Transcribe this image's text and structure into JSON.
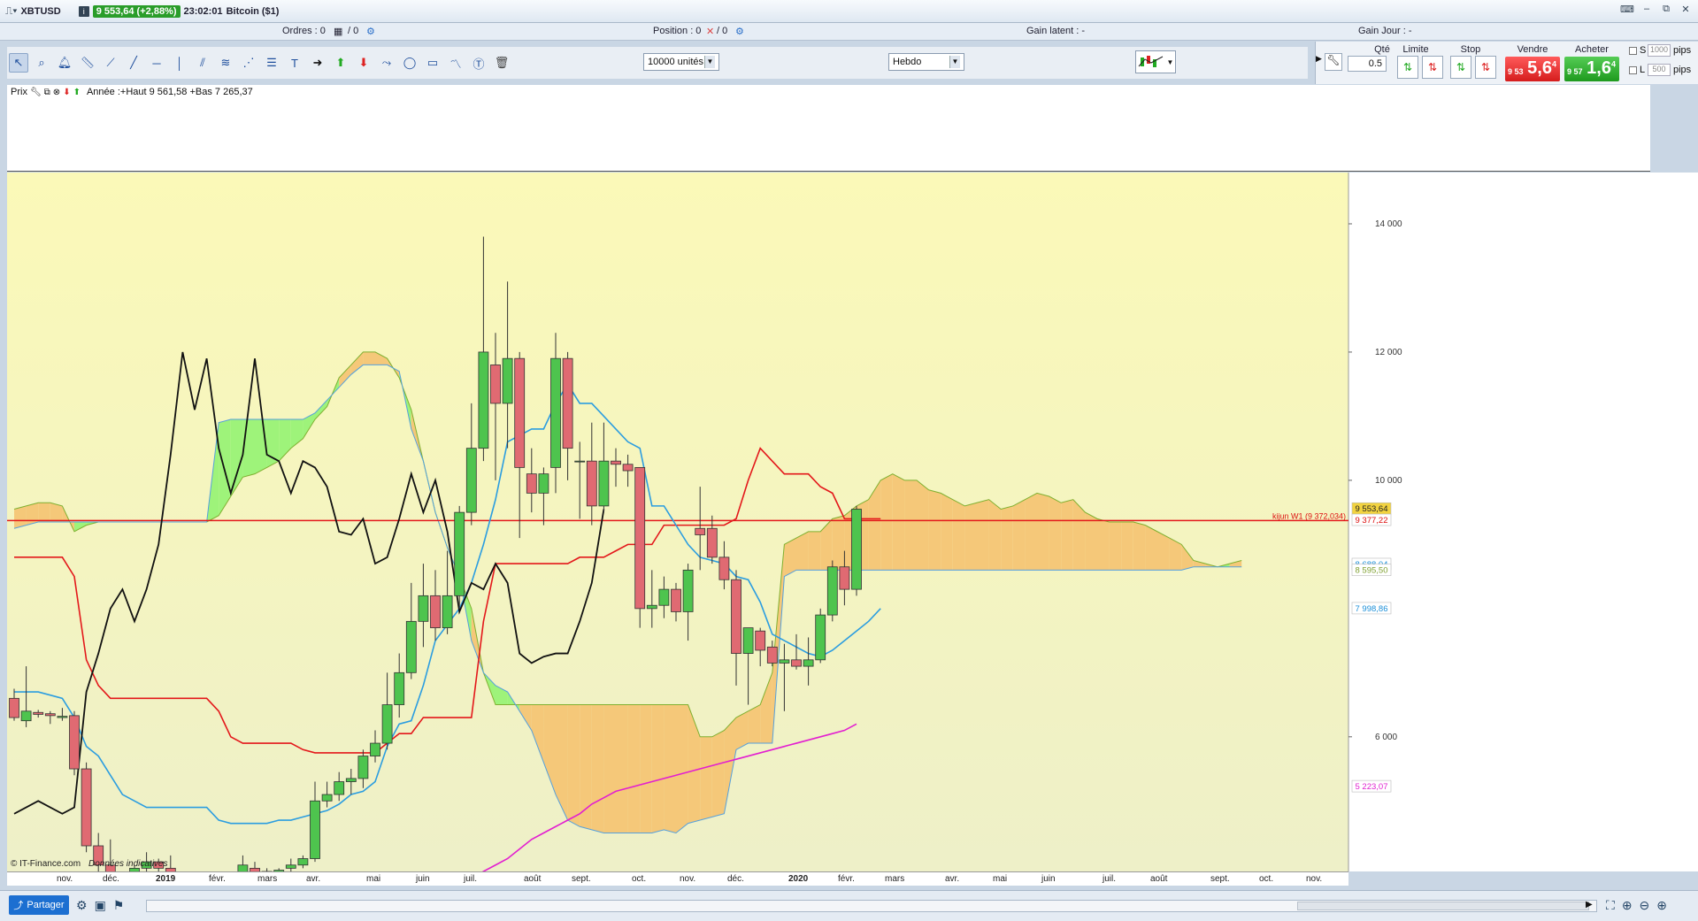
{
  "window": {
    "symbol": "XBTUSD",
    "price_badge": "9 553,64 (+2,88%)",
    "time": "23:02:01",
    "instrument": "Bitcoin ($1)"
  },
  "status": {
    "ordres": "Ordres : 0",
    "ordres_total": "/ 0",
    "position": "Position : 0",
    "position_total": "/ 0",
    "gain_latent": "Gain latent : -",
    "gain_jour": "Gain Jour : -"
  },
  "toolbar": {
    "units_select": "10000 unités",
    "period_select": "Hebdo"
  },
  "order_panel": {
    "qty_label": "Qté",
    "qty_value": "0.5",
    "limit_label": "Limite",
    "stop_label": "Stop",
    "sell_label": "Vendre",
    "buy_label": "Acheter",
    "sell_small": "9 53",
    "sell_big": "5,6",
    "sell_sup": "4",
    "buy_small": "9 57",
    "buy_big": "1,6",
    "buy_sup": "4",
    "s_label": "S",
    "l_label": "L",
    "s_pips": "1000",
    "l_pips": "500",
    "pips": "pips",
    "pips2": "pips"
  },
  "indicator_bar": {
    "prix_label": "Prix",
    "legend_text": "Année :+Haut 9 561,58 +Bas 7 265,37"
  },
  "chart_data": {
    "type": "candlestick",
    "ylim": [
      3900,
      14800
    ],
    "y_ticks": [
      "14 000",
      "12 000",
      "10 000",
      "6 000"
    ],
    "y_tick_values": [
      14000,
      12000,
      10000,
      6000
    ],
    "x_labels": [
      "nov.",
      "déc.",
      "2019",
      "févr.",
      "mars",
      "avr.",
      "mai",
      "juin",
      "juil.",
      "août",
      "sept.",
      "oct.",
      "nov.",
      "déc.",
      "2020",
      "févr.",
      "mars",
      "avr.",
      "mai",
      "juin",
      "juil.",
      "août",
      "sept.",
      "oct.",
      "nov."
    ],
    "x_bold": [
      "2019",
      "2020"
    ],
    "candles": [
      {
        "o": 6600,
        "h": 6750,
        "l": 6250,
        "c": 6300
      },
      {
        "o": 6250,
        "h": 7100,
        "l": 6150,
        "c": 6400
      },
      {
        "o": 6380,
        "h": 6420,
        "l": 6300,
        "c": 6350
      },
      {
        "o": 6360,
        "h": 6400,
        "l": 6200,
        "c": 6330
      },
      {
        "o": 6300,
        "h": 6450,
        "l": 6250,
        "c": 6320
      },
      {
        "o": 6330,
        "h": 6400,
        "l": 5400,
        "c": 5500
      },
      {
        "o": 5500,
        "h": 5600,
        "l": 4200,
        "c": 4300
      },
      {
        "o": 4300,
        "h": 4500,
        "l": 3700,
        "c": 4000
      },
      {
        "o": 4000,
        "h": 4400,
        "l": 3300,
        "c": 3500
      },
      {
        "o": 3500,
        "h": 3800,
        "l": 3200,
        "c": 3300
      },
      {
        "o": 3300,
        "h": 4000,
        "l": 3200,
        "c": 3950
      },
      {
        "o": 3950,
        "h": 4200,
        "l": 3800,
        "c": 4050
      },
      {
        "o": 4050,
        "h": 4100,
        "l": 3850,
        "c": 3950
      },
      {
        "o": 3950,
        "h": 4150,
        "l": 3650,
        "c": 3750
      },
      {
        "o": 3750,
        "h": 3850,
        "l": 3550,
        "c": 3650
      },
      {
        "o": 3650,
        "h": 3750,
        "l": 3450,
        "c": 3550
      },
      {
        "o": 3550,
        "h": 3700,
        "l": 3450,
        "c": 3650
      },
      {
        "o": 3620,
        "h": 3700,
        "l": 3500,
        "c": 3600
      },
      {
        "o": 3600,
        "h": 3900,
        "l": 3550,
        "c": 3750
      },
      {
        "o": 3700,
        "h": 4150,
        "l": 3650,
        "c": 4000
      },
      {
        "o": 3950,
        "h": 4050,
        "l": 3800,
        "c": 3880
      },
      {
        "o": 3880,
        "h": 3950,
        "l": 3800,
        "c": 3900
      },
      {
        "o": 3880,
        "h": 3950,
        "l": 3800,
        "c": 3920
      },
      {
        "o": 3950,
        "h": 4100,
        "l": 3900,
        "c": 4000
      },
      {
        "o": 4000,
        "h": 4150,
        "l": 3950,
        "c": 4100
      },
      {
        "o": 4100,
        "h": 5300,
        "l": 4050,
        "c": 5000
      },
      {
        "o": 5000,
        "h": 5300,
        "l": 4900,
        "c": 5100
      },
      {
        "o": 5100,
        "h": 5450,
        "l": 5000,
        "c": 5300
      },
      {
        "o": 5300,
        "h": 5500,
        "l": 5100,
        "c": 5350
      },
      {
        "o": 5350,
        "h": 5800,
        "l": 5200,
        "c": 5700
      },
      {
        "o": 5700,
        "h": 6100,
        "l": 5600,
        "c": 5900
      },
      {
        "o": 5900,
        "h": 7000,
        "l": 5800,
        "c": 6500
      },
      {
        "o": 6500,
        "h": 7300,
        "l": 6300,
        "c": 7000
      },
      {
        "o": 7000,
        "h": 8400,
        "l": 6900,
        "c": 7800
      },
      {
        "o": 7800,
        "h": 8700,
        "l": 7400,
        "c": 8200
      },
      {
        "o": 8200,
        "h": 8600,
        "l": 7500,
        "c": 7700
      },
      {
        "o": 7700,
        "h": 8900,
        "l": 7600,
        "c": 8200
      },
      {
        "o": 8200,
        "h": 9600,
        "l": 8000,
        "c": 9500
      },
      {
        "o": 9500,
        "h": 11200,
        "l": 9300,
        "c": 10500
      },
      {
        "o": 10500,
        "h": 13800,
        "l": 10300,
        "c": 12000
      },
      {
        "o": 11800,
        "h": 12300,
        "l": 10000,
        "c": 11200
      },
      {
        "o": 11200,
        "h": 13100,
        "l": 10500,
        "c": 11900
      },
      {
        "o": 11900,
        "h": 12000,
        "l": 9100,
        "c": 10200
      },
      {
        "o": 10100,
        "h": 10500,
        "l": 9500,
        "c": 9800
      },
      {
        "o": 9800,
        "h": 10200,
        "l": 9300,
        "c": 10100
      },
      {
        "o": 10200,
        "h": 12300,
        "l": 9800,
        "c": 11900
      },
      {
        "o": 11900,
        "h": 12000,
        "l": 10000,
        "c": 10500
      },
      {
        "o": 10300,
        "h": 10600,
        "l": 9400,
        "c": 10300
      },
      {
        "o": 10300,
        "h": 10900,
        "l": 9300,
        "c": 9600
      },
      {
        "o": 9600,
        "h": 10900,
        "l": 9500,
        "c": 10300
      },
      {
        "o": 10300,
        "h": 10500,
        "l": 9900,
        "c": 10250
      },
      {
        "o": 10250,
        "h": 10400,
        "l": 9900,
        "c": 10150
      },
      {
        "o": 10200,
        "h": 10200,
        "l": 7700,
        "c": 8000
      },
      {
        "o": 8000,
        "h": 8600,
        "l": 7700,
        "c": 8050
      },
      {
        "o": 8050,
        "h": 8500,
        "l": 7850,
        "c": 8300
      },
      {
        "o": 8300,
        "h": 8400,
        "l": 7800,
        "c": 7950
      },
      {
        "o": 7950,
        "h": 8700,
        "l": 7500,
        "c": 8600
      },
      {
        "o": 9250,
        "h": 9900,
        "l": 8600,
        "c": 9150
      },
      {
        "o": 9250,
        "h": 9450,
        "l": 8700,
        "c": 8800
      },
      {
        "o": 8800,
        "h": 9050,
        "l": 8300,
        "c": 8450
      },
      {
        "o": 8450,
        "h": 8600,
        "l": 6800,
        "c": 7300
      },
      {
        "o": 7300,
        "h": 7700,
        "l": 6500,
        "c": 7700
      },
      {
        "o": 7650,
        "h": 7700,
        "l": 7100,
        "c": 7350
      },
      {
        "o": 7400,
        "h": 7500,
        "l": 7100,
        "c": 7150
      },
      {
        "o": 7150,
        "h": 7450,
        "l": 6400,
        "c": 7200
      },
      {
        "o": 7200,
        "h": 7600,
        "l": 7050,
        "c": 7100
      },
      {
        "o": 7100,
        "h": 7550,
        "l": 6800,
        "c": 7200
      },
      {
        "o": 7200,
        "h": 8000,
        "l": 7150,
        "c": 7900
      },
      {
        "o": 7900,
        "h": 8750,
        "l": 7800,
        "c": 8650
      },
      {
        "o": 8650,
        "h": 8900,
        "l": 8050,
        "c": 8300
      },
      {
        "o": 8300,
        "h": 9600,
        "l": 8200,
        "c": 9550
      }
    ],
    "tenkan_line": [
      6700,
      6700,
      6700,
      6650,
      6600,
      6300,
      5850,
      5700,
      5400,
      5100,
      5000,
      4900,
      4900,
      4900,
      4900,
      4900,
      4900,
      4700,
      4650,
      4650,
      4650,
      4650,
      4700,
      4700,
      4750,
      4800,
      4850,
      4950,
      5100,
      5150,
      5300,
      5850,
      6200,
      6250,
      6800,
      7500,
      7750,
      8000,
      8400,
      9000,
      9700,
      10600,
      10700,
      10800,
      10800,
      11200,
      11500,
      11200,
      11200,
      11000,
      10800,
      10600,
      10500,
      9600,
      9600,
      9300,
      9000,
      8800,
      8750,
      8700,
      8500,
      8450,
      8100,
      7600,
      7500,
      7400,
      7300,
      7250,
      7350,
      7500,
      7650,
      7800,
      8000
    ],
    "kijun_line": [
      8800,
      8800,
      8800,
      8800,
      8800,
      8500,
      7200,
      6800,
      6600,
      6600,
      6600,
      6600,
      6600,
      6600,
      6600,
      6600,
      6600,
      6400,
      6000,
      5900,
      5900,
      5900,
      5900,
      5900,
      5800,
      5750,
      5750,
      5750,
      5750,
      5750,
      5750,
      5900,
      6050,
      6050,
      6300,
      6300,
      6300,
      6300,
      6300,
      7800,
      8700,
      8700,
      8700,
      8700,
      8700,
      8700,
      8700,
      8800,
      8800,
      8800,
      8900,
      9000,
      9000,
      9000,
      9300,
      9300,
      9300,
      9300,
      9300,
      9300,
      9400,
      10000,
      10500,
      10300,
      10100,
      10100,
      10100,
      9900,
      9800,
      9400,
      9400,
      9400,
      9400
    ],
    "chikou_line": [
      4800,
      4900,
      5000,
      4900,
      4800,
      4900,
      6700,
      7300,
      8000,
      8300,
      7800,
      8300,
      9000,
      10400,
      12000,
      11100,
      11900,
      10500,
      9800,
      10400,
      11900,
      10400,
      10300,
      9800,
      10300,
      10200,
      9900,
      9200,
      9150,
      9400,
      8700,
      8800,
      9400,
      10100,
      9500,
      10000,
      9200,
      7950,
      8400,
      8300,
      8700,
      8400,
      7300,
      7150,
      7250,
      7300,
      7300,
      7800,
      8400,
      9550
    ],
    "sma_line": [
      3300,
      3400,
      3450,
      3500,
      3600,
      3700,
      3800,
      3900,
      4000,
      4100,
      4250,
      4400,
      4500,
      4600,
      4700,
      4800,
      4950,
      5050,
      5150,
      5200,
      5250,
      5300,
      5350,
      5400,
      5450,
      5500,
      5550,
      5600,
      5650,
      5700,
      5750,
      5800,
      5850,
      5900,
      5950,
      6000,
      6050,
      6100,
      6200
    ],
    "cloud_a": [
      9550,
      9600,
      9650,
      9650,
      9600,
      9200,
      9300,
      9350,
      9350,
      9350,
      9350,
      9350,
      9350,
      9350,
      9350,
      9350,
      9350,
      9450,
      9750,
      10050,
      10100,
      10200,
      10300,
      10500,
      10650,
      10950,
      11150,
      11600,
      11800,
      12000,
      12000,
      11900,
      11600,
      11100,
      10300,
      9500,
      8950,
      8500,
      8000,
      7000,
      6500,
      6500,
      6500,
      6500,
      6500,
      6500,
      6500,
      6500,
      6500,
      6500,
      6500,
      6500,
      6500,
      6500,
      6500,
      6500,
      6500,
      6000,
      6000,
      6100,
      6300,
      6400,
      6500,
      7000,
      9000,
      9100,
      9200,
      9200,
      9400,
      9450,
      9600,
      9700,
      10000,
      10100,
      10000,
      10000,
      9850,
      9800,
      9700,
      9600,
      9650,
      9700,
      9550,
      9600,
      9700,
      9800,
      9750,
      9650,
      9700,
      9500,
      9400,
      9350,
      9350,
      9350,
      9300,
      9200,
      9100,
      9000,
      8750,
      8700,
      8650,
      8700,
      8750
    ],
    "cloud_b": [
      9250,
      9300,
      9350,
      9350,
      9350,
      9350,
      9350,
      9350,
      9350,
      9350,
      9350,
      9350,
      9350,
      9350,
      9350,
      9350,
      9350,
      10900,
      10950,
      10950,
      10950,
      10950,
      10950,
      10950,
      10950,
      11050,
      11250,
      11450,
      11650,
      11800,
      11800,
      11800,
      11700,
      10800,
      10300,
      9500,
      8950,
      8500,
      7500,
      7000,
      6800,
      6700,
      6400,
      6100,
      5600,
      5100,
      4700,
      4600,
      4550,
      4500,
      4500,
      4500,
      4500,
      4500,
      4550,
      4500,
      4650,
      4700,
      4750,
      4800,
      5800,
      5900,
      5900,
      5900,
      8500,
      8600,
      8600,
      8600,
      8600,
      8600,
      8600,
      8600,
      8600,
      8600,
      8600,
      8600,
      8600,
      8600,
      8600,
      8600,
      8600,
      8600,
      8600,
      8600,
      8600,
      8600,
      8600,
      8600,
      8600,
      8600,
      8600,
      8600,
      8600,
      8600,
      8600,
      8600,
      8600,
      8600,
      8650,
      8650,
      8650,
      8650,
      8650
    ],
    "hline": 9372.034,
    "hline_label": "kijun W1 (9 372,034)",
    "right_labels": [
      {
        "text": "9 553,64",
        "value": 9553.64,
        "bg": "#f2d340",
        "fg": "#222"
      },
      {
        "text": "9 377,22",
        "value": 9377.22,
        "bg": "#fff",
        "fg": "#d11"
      },
      {
        "text": "8 688,04",
        "value": 8688.04,
        "bg": "#fff",
        "fg": "#1b8fd8"
      },
      {
        "text": "8 595,50",
        "value": 8595.5,
        "bg": "#fff",
        "fg": "#7fa030"
      },
      {
        "text": "7 998,86",
        "value": 7998.86,
        "bg": "#fff",
        "fg": "#1b8fd8"
      },
      {
        "text": "5 223,07",
        "value": 5223.07,
        "bg": "#fff",
        "fg": "#e020d0"
      }
    ],
    "watermark": "© IT-Finance.com",
    "watermark_italic": "Données indicatives",
    "colors": {
      "bg": "#f7f5c0",
      "cloud_bull": "#9ef37a",
      "cloud_bear": "#f5c879",
      "tenkan": "#2b9de0",
      "kijun": "#e3171a",
      "chikou": "#111111",
      "sma": "#e21fd0",
      "up": "#4ec44e",
      "down": "#e06a72"
    }
  },
  "bottom": {
    "share_label": "Partager"
  }
}
